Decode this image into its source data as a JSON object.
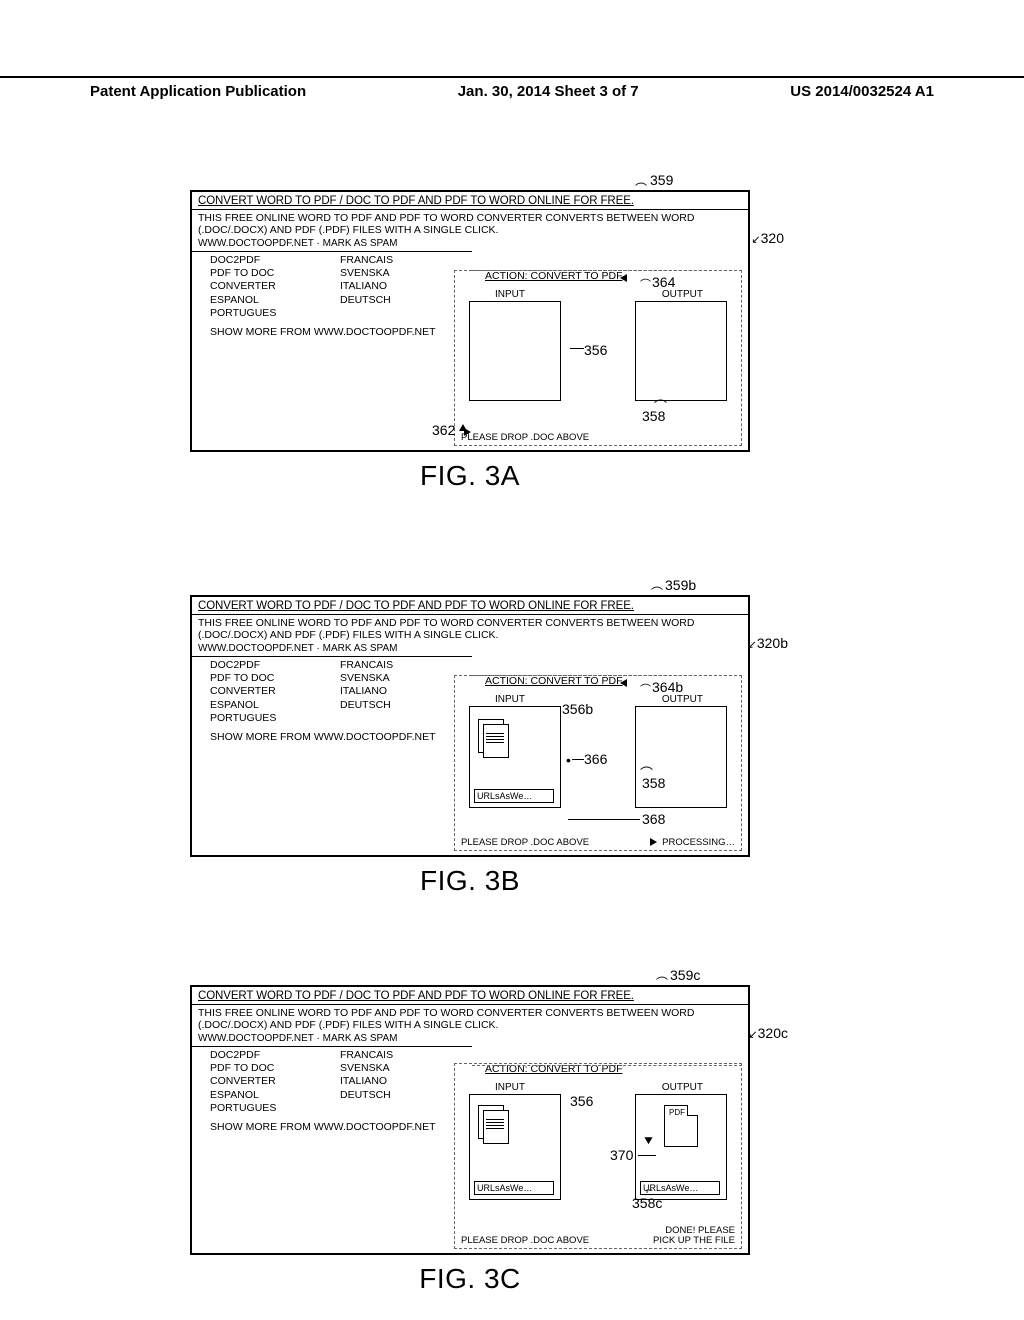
{
  "header": {
    "left": "Patent Application Publication",
    "center": "Jan. 30, 2014  Sheet 3 of 7",
    "right": "US 2014/0032524 A1"
  },
  "common": {
    "title": "CONVERT WORD TO PDF / DOC TO PDF AND PDF TO WORD ONLINE FOR FREE.",
    "desc": "THIS FREE ONLINE WORD TO PDF AND PDF TO WORD CONVERTER CONVERTS BETWEEN WORD (.DOC/.DOCX) AND PDF (.PDF) FILES WITH A SINGLE CLICK.",
    "src": "WWW.DOCTOOPDF.NET · MARK AS SPAM",
    "links_left": [
      "DOC2PDF",
      "PDF TO DOC CONVERTER",
      "ESPANOL",
      "PORTUGUES"
    ],
    "links_right": [
      "FRANCAIS",
      "SVENSKA",
      "ITALIANO",
      "DEUTSCH"
    ],
    "show_more": "SHOW MORE FROM WWW.DOCTOOPDF.NET",
    "action_label": "ACTION: CONVERT TO PDF",
    "input_label": "INPUT",
    "output_label": "OUTPUT",
    "drop_msg": "PLEASE DROP .DOC ABOVE",
    "filename": "URLsAsWe…"
  },
  "figA": {
    "caption": "FIG. 3A",
    "refs": {
      "r359": "359",
      "r320": "320",
      "r364": "364",
      "r356": "356",
      "r358": "358",
      "r362": "362"
    }
  },
  "figB": {
    "caption": "FIG. 3B",
    "status": "PROCESSING…",
    "refs": {
      "r359b": "359b",
      "r320b": "320b",
      "r364b": "364b",
      "r356b": "356b",
      "r366": "366",
      "r358": "358",
      "r368": "368"
    }
  },
  "figC": {
    "caption": "FIG. 3C",
    "status": "DONE! PLEASE\nPICK UP THE FILE",
    "pdf_label": "PDF",
    "refs": {
      "r359c": "359c",
      "r320c": "320c",
      "r356": "356",
      "r370": "370",
      "r358c": "358c"
    }
  }
}
